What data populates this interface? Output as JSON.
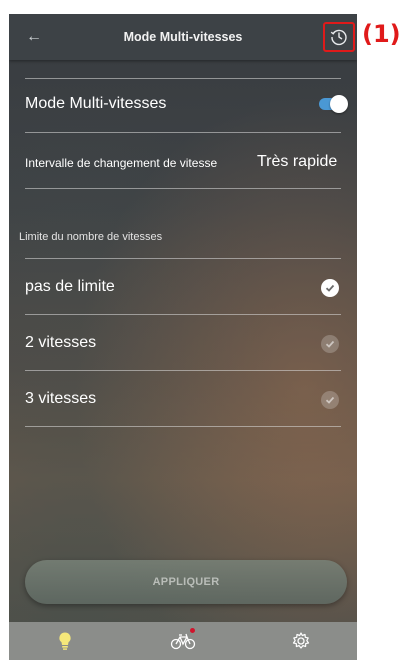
{
  "header": {
    "title": "Mode Multi-vitesses",
    "back_icon": "arrow-left-icon",
    "history_icon": "history-clock-icon"
  },
  "callout": {
    "label": "(1)",
    "color": "#e01a1a"
  },
  "settings": {
    "multi_mode_label": "Mode Multi-vitesses",
    "multi_mode_enabled": true,
    "interval_label": "Intervalle de changement de vitesse",
    "interval_value": "Très rapide"
  },
  "limit_section": {
    "heading": "Limite du nombre de vitesses",
    "options": [
      {
        "label": "pas de limite",
        "selected": true
      },
      {
        "label": "2 vitesses",
        "selected": false
      },
      {
        "label": "3 vitesses",
        "selected": false
      }
    ]
  },
  "apply_button": {
    "label": "APPLIQUER"
  },
  "tabbar": {
    "tabs": [
      {
        "icon": "lightbulb-icon",
        "active": true
      },
      {
        "icon": "bicycle-icon",
        "active": false,
        "has_notification": true
      },
      {
        "icon": "gear-icon",
        "active": false
      }
    ]
  },
  "colors": {
    "accent_toggle": "#4a98d4",
    "active_tab": "#f5e87a",
    "notification": "#d0142c",
    "highlight_box": "#e01a1a"
  }
}
